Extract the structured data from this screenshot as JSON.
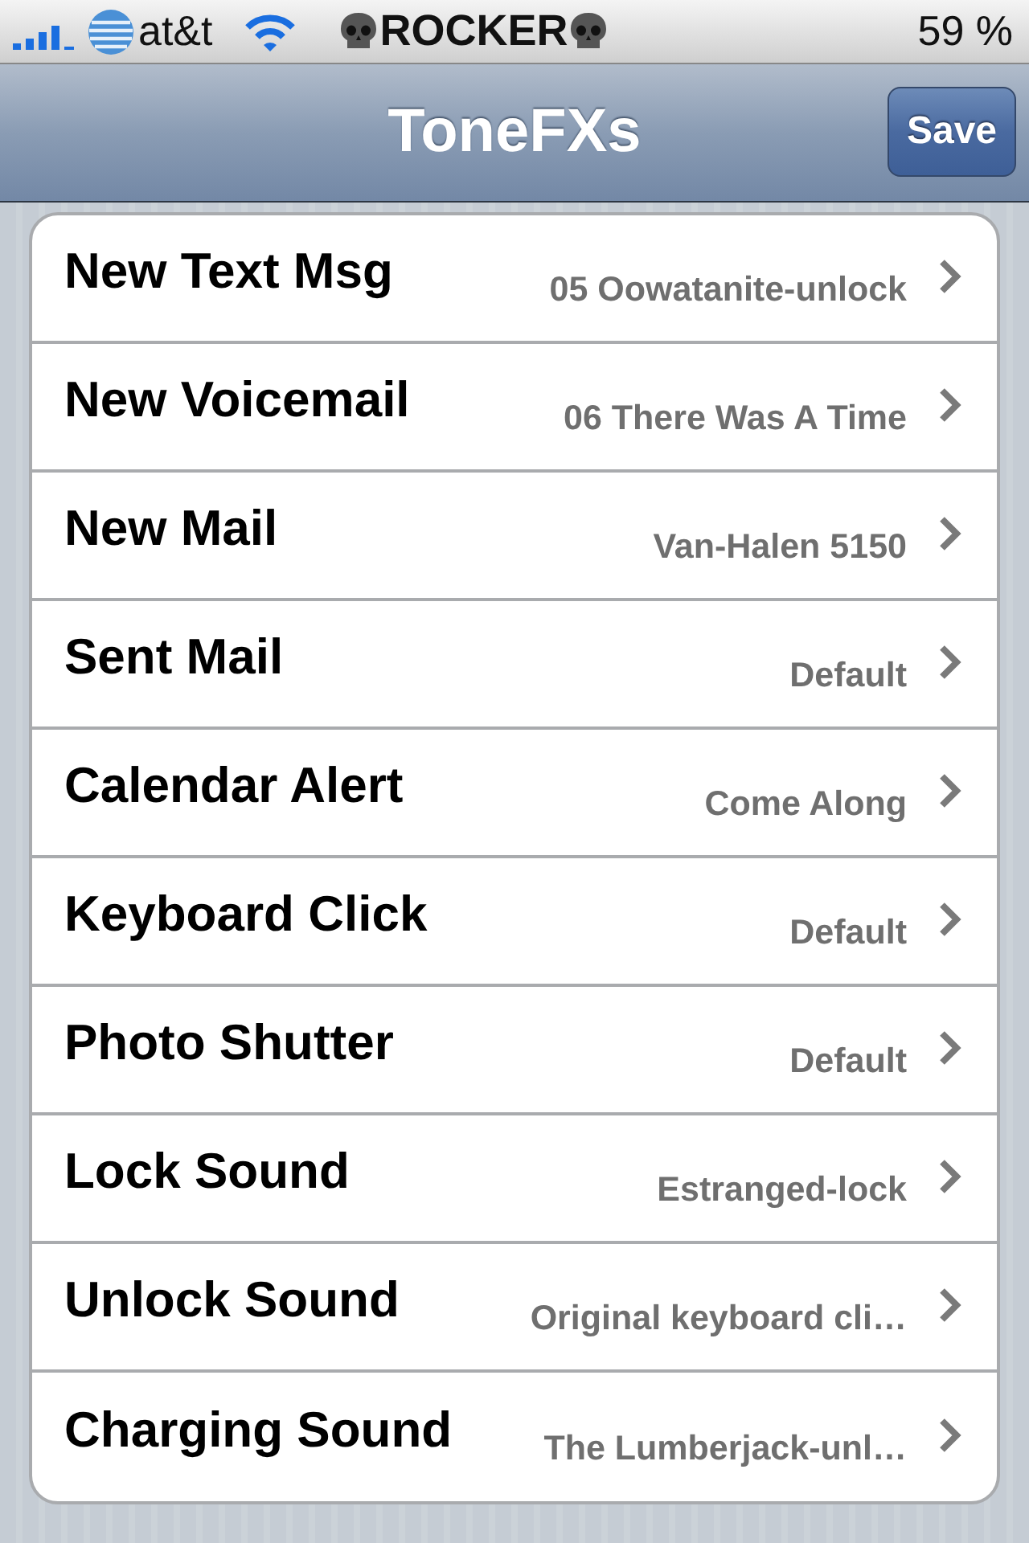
{
  "status_bar": {
    "carrier": "at&t",
    "title": "ROCKER",
    "battery": "59 %"
  },
  "nav_bar": {
    "title": "ToneFXs",
    "save_button": "Save"
  },
  "rows": [
    {
      "label": "New Text Msg",
      "value": "05 Oowatanite-unlock"
    },
    {
      "label": "New Voicemail",
      "value": "06 There Was A Time"
    },
    {
      "label": "New Mail",
      "value": "Van-Halen 5150"
    },
    {
      "label": "Sent Mail",
      "value": "Default"
    },
    {
      "label": "Calendar Alert",
      "value": "Come Along"
    },
    {
      "label": "Keyboard Click",
      "value": "Default"
    },
    {
      "label": "Photo Shutter",
      "value": "Default"
    },
    {
      "label": "Lock Sound",
      "value": "Estranged-lock"
    },
    {
      "label": "Unlock Sound",
      "value": "Original keyboard cli…"
    },
    {
      "label": "Charging Sound",
      "value": "The Lumberjack-unl…"
    }
  ]
}
